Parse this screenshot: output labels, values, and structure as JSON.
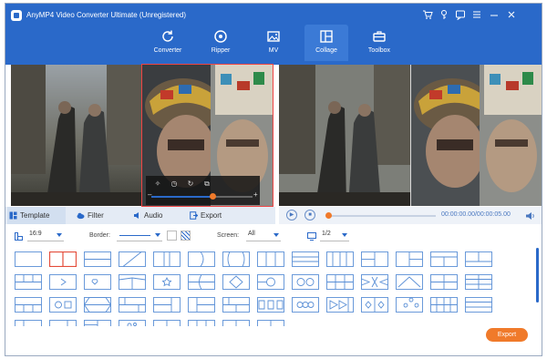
{
  "app": {
    "title": "AnyMP4 Video Converter Ultimate (Unregistered)",
    "window_controls": [
      "cart-icon",
      "key-icon",
      "feedback-icon",
      "menu-icon",
      "minimize-icon",
      "close-icon"
    ]
  },
  "nav": {
    "tabs": [
      {
        "label": "Converter",
        "icon": "refresh-icon",
        "active": false
      },
      {
        "label": "Ripper",
        "icon": "disc-icon",
        "active": false
      },
      {
        "label": "MV",
        "icon": "image-icon",
        "active": false
      },
      {
        "label": "Collage",
        "icon": "collage-icon",
        "active": true
      },
      {
        "label": "Toolbox",
        "icon": "toolbox-icon",
        "active": false
      }
    ]
  },
  "editor": {
    "tabs": [
      {
        "label": "Template",
        "icon": "grid-icon",
        "active": true
      },
      {
        "label": "Filter",
        "icon": "cloud-icon",
        "active": false
      },
      {
        "label": "Audio",
        "icon": "speaker-icon",
        "active": false
      },
      {
        "label": "Export",
        "icon": "export-icon",
        "active": false
      }
    ],
    "volume_fraction": 0.6
  },
  "playback": {
    "time": "00:00:00.00/00:00:05.00",
    "progress_fraction": 0.0
  },
  "options": {
    "aspect_ratio": "16:9",
    "border_label": "Border:",
    "screen_label": "Screen:",
    "screen_value": "All",
    "page": "1/2"
  },
  "actions": {
    "export_label": "Export"
  },
  "colors": {
    "brand": "#2a69c9",
    "accent": "#f07a2a",
    "template_outline": "#5a8fd6",
    "template_selected": "#e44c3a"
  }
}
